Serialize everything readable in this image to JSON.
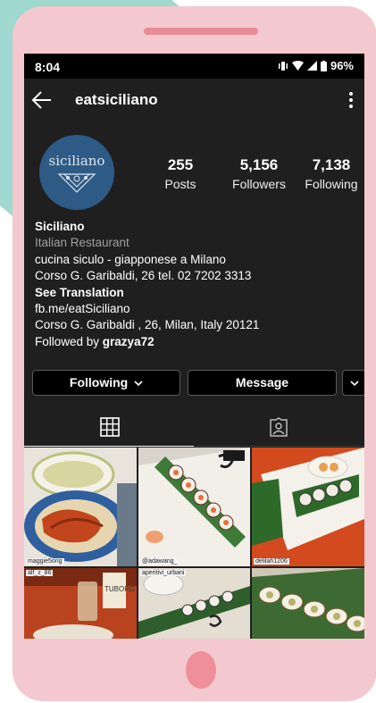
{
  "status": {
    "time": "8:04",
    "battery": "96%"
  },
  "profile": {
    "username": "eatsiciliano",
    "avatar_text": "siciliano",
    "stats": [
      {
        "num": "255",
        "label": "Posts"
      },
      {
        "num": "5,156",
        "label": "Followers"
      },
      {
        "num": "7,138",
        "label": "Following"
      }
    ],
    "name": "Siciliano",
    "category": "Italian Restaurant",
    "bio_line1": "cucina siculo - giapponese a Milano",
    "bio_line2": "Corso G. Garibaldi, 26 tel. 02 7202 3313",
    "see_translation": "See Translation",
    "link": "fb.me/eatSiciliano",
    "address": "Corso G. Garibaldi , 26, Milan, Italy 20121",
    "followed_by_prefix": "Followed by ",
    "followed_by_user": "grazya72"
  },
  "actions": {
    "following": "Following",
    "message": "Message"
  },
  "posts": [
    {
      "caption": "maggie5ong"
    },
    {
      "caption": "@adawang_"
    },
    {
      "caption": "delilah1206"
    },
    {
      "caption": "alf_z_86"
    },
    {
      "caption": "aperitivi_urbani"
    },
    {
      "caption": ""
    }
  ],
  "colors": {
    "phone": "#f3c9cf",
    "accent_pink": "#e78c98",
    "bg_shape": "#9ed8cf",
    "screen": "#1f1f1f"
  }
}
